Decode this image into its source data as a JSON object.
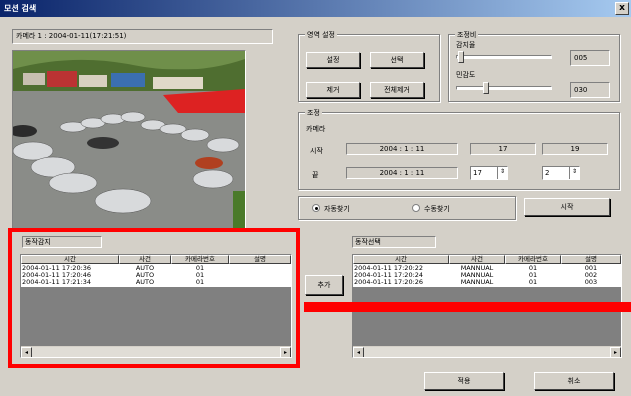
{
  "window": {
    "title": "모션 검색",
    "close_label": "x"
  },
  "camera_info": "카메라 1 : 2004-01-11(17:21:51)",
  "area_setting": {
    "label": "영역 설정",
    "set_button": "설정",
    "select_button": "선택",
    "remove_button": "제거",
    "remove_all_button": "전체제거"
  },
  "adjust_ratio": {
    "label": "조정비",
    "sensitivity_label": "감지율",
    "sensitivity_value": "005",
    "sensitivity_level": 0.02,
    "sensitivity2_label": "민감도",
    "sensitivity2_value": "030",
    "sensitivity2_level": 0.3
  },
  "adjust": {
    "label": "조정",
    "camera_label": "카메라",
    "start_label": "시작",
    "end_label": "끝",
    "start_date": "2004 : 1 : 11",
    "start_hour": "17",
    "start_min": "19",
    "end_date": "2004 : 1 : 11",
    "end_hour": "17",
    "end_min": "2"
  },
  "search": {
    "auto_label": "자동찾기",
    "manual_label": "수동찾기",
    "start_button": "시작"
  },
  "motion_detect": {
    "label": "동작감지",
    "columns": [
      "시간",
      "사건",
      "카메라번호",
      "설명"
    ],
    "rows": [
      [
        "2004-01-11 17:20:36",
        "AUTO",
        "01",
        ""
      ],
      [
        "2004-01-11 17:20:46",
        "AUTO",
        "01",
        ""
      ],
      [
        "2004-01-11 17:21:34",
        "AUTO",
        "01",
        ""
      ]
    ]
  },
  "add_button": "추가",
  "motion_select": {
    "label": "동작선택",
    "columns": [
      "시간",
      "사건",
      "카메라번호",
      "설명"
    ],
    "rows": [
      [
        "2004-01-11 17:20:22",
        "MANNUAL",
        "01",
        "001"
      ],
      [
        "2004-01-11 17:20:24",
        "MANNUAL",
        "01",
        "002"
      ],
      [
        "2004-01-11 17:20:26",
        "MANNUAL",
        "01",
        "003"
      ]
    ]
  },
  "footer": {
    "apply_button": "적용",
    "cancel_button": "취소"
  },
  "colors": {
    "highlight": "#ff0000",
    "title_bar": "#0a246a"
  }
}
